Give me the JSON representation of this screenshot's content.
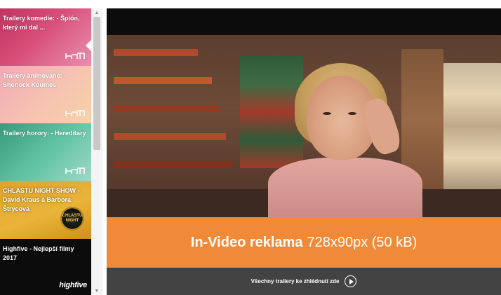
{
  "playlist": {
    "items": [
      {
        "title": "Trailery komedie: - Špión, který mi dal ...",
        "icon": "cinema-seats-icon",
        "color": "#c0335f"
      },
      {
        "title": "Trailery animované: - Sherlock Koumes",
        "icon": "cinema-seats-icon",
        "color": "#f2aab6"
      },
      {
        "title": "Trailery horory: - Hereditary",
        "icon": "cinema-seats-icon",
        "color": "#3a9a7b"
      },
      {
        "title": "CHLASTU NIGHT SHOW - David Kraus a Barbora Štrýcová",
        "logo": "CHLASTU NIGHT",
        "color": "#e0a329"
      },
      {
        "title": "Highfive - Nejlepší filmy 2017",
        "logo": "highfive",
        "color": "#0c0c0c"
      }
    ],
    "scroll_up_icon": "chevron-up-icon",
    "scroll_down_icon": "chevron-down-icon"
  },
  "ad": {
    "label": "In-Video reklama",
    "size": "728x90px (50 kB)",
    "color": "#f18a38"
  },
  "footer": {
    "link_text": "Všechny trailery ke zhlédnutí zde",
    "icon": "play-circle-icon"
  }
}
